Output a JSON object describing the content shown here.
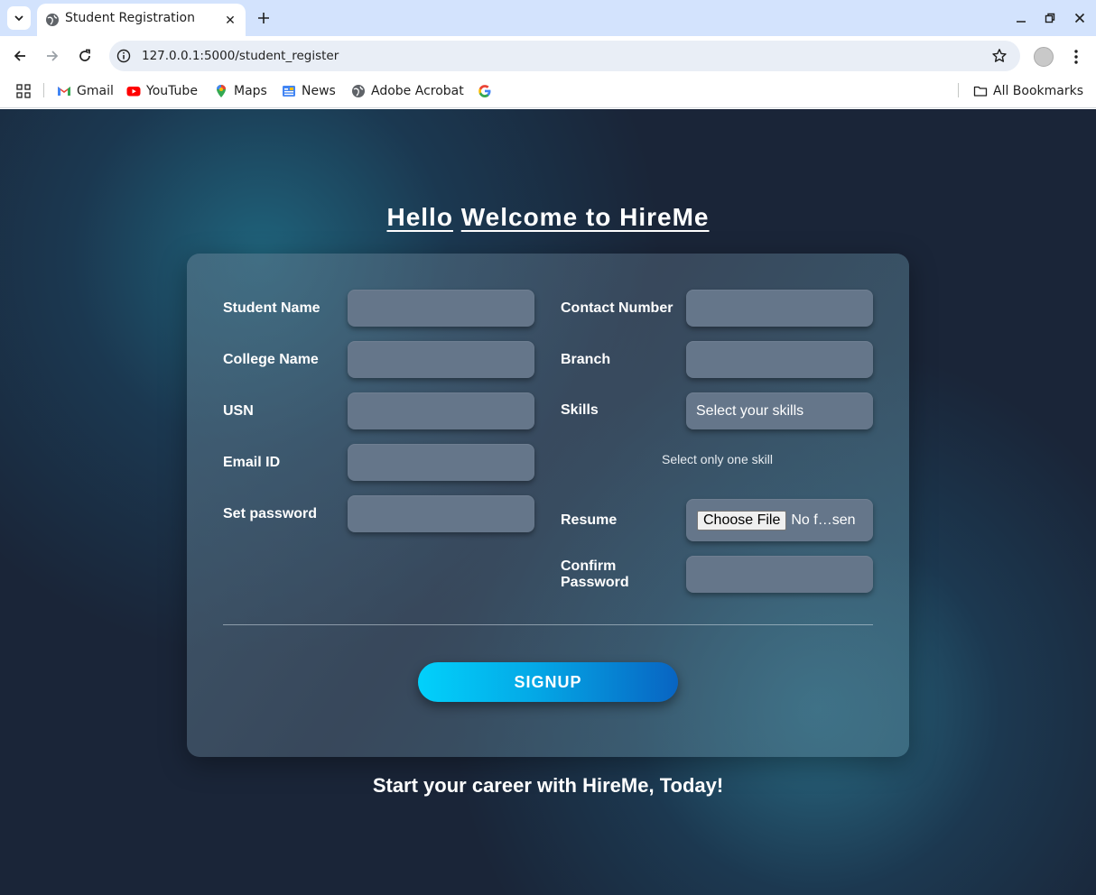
{
  "browser": {
    "tab_title": "Student Registration",
    "url": "127.0.0.1:5000/student_register",
    "bookmarks": [
      "Gmail",
      "YouTube",
      "Maps",
      "News",
      "Adobe Acrobat"
    ],
    "all_bookmarks": "All Bookmarks"
  },
  "page": {
    "heading_hello": "Hello",
    "heading_welcome": "Welcome to HireMe",
    "labels": {
      "student_name": "Student Name",
      "college_name": "College Name",
      "usn": "USN",
      "email": "Email ID",
      "set_password": "Set password",
      "contact_number": "Contact Number",
      "branch": "Branch",
      "skills": "Skills",
      "resume": "Resume",
      "confirm_password": "Confirm Password"
    },
    "values": {
      "student_name": "",
      "college_name": "",
      "usn": "",
      "email": "",
      "set_password": "",
      "contact_number": "",
      "branch": "",
      "confirm_password": ""
    },
    "skills_select": "Select your skills",
    "skills_hint": "Select only one skill",
    "file_button": "Choose File",
    "file_status": "No f…sen",
    "signup_label": "SIGNUP",
    "tagline": "Start your career with HireMe, Today!"
  },
  "colors": {
    "tabbar": "#d3e3fd",
    "page_bg": "#1a2538",
    "card_bg": "#5a7387",
    "field_bg": "#65768a",
    "signup_start": "#02d1fb",
    "signup_end": "#0864c2"
  },
  "icons": [
    "tab-list-icon",
    "globe-icon",
    "close-icon",
    "plus-icon",
    "minimize-icon",
    "restore-icon",
    "back-icon",
    "forward-icon",
    "reload-icon",
    "site-info-icon",
    "star-icon",
    "profile-avatar",
    "menu-icon",
    "apps-icon",
    "gmail-icon",
    "youtube-icon",
    "maps-icon",
    "news-icon",
    "google-icon",
    "folder-icon"
  ]
}
